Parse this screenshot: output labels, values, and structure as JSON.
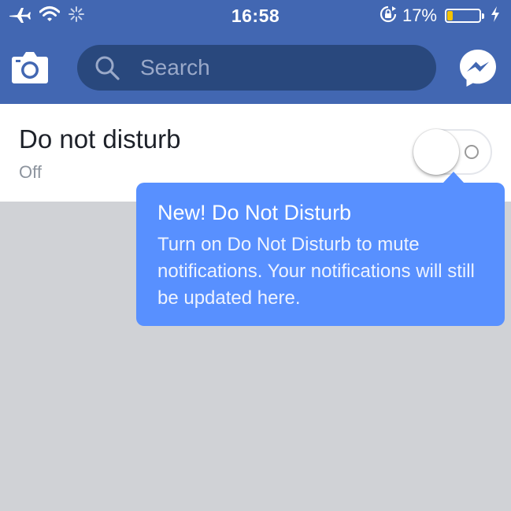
{
  "status_bar": {
    "time": "16:58",
    "battery_percent": "17%",
    "battery_level": 0.17,
    "battery_color": "#f5c400",
    "icons": [
      "airplane-icon",
      "wifi-icon",
      "activity-spinner-icon",
      "rotation-lock-icon",
      "battery-icon",
      "charging-bolt-icon"
    ]
  },
  "nav": {
    "search_placeholder": "Search",
    "icons": [
      "camera-icon",
      "search-icon",
      "messenger-icon"
    ],
    "bar_color": "#4267b2"
  },
  "setting": {
    "title": "Do not disturb",
    "subtitle": "Off",
    "toggle_on": false
  },
  "tooltip": {
    "title": "New! Do Not Disturb",
    "body": "Turn on Do Not Disturb to mute notifications. Your notifications will still be updated here.",
    "color": "#5890ff"
  }
}
